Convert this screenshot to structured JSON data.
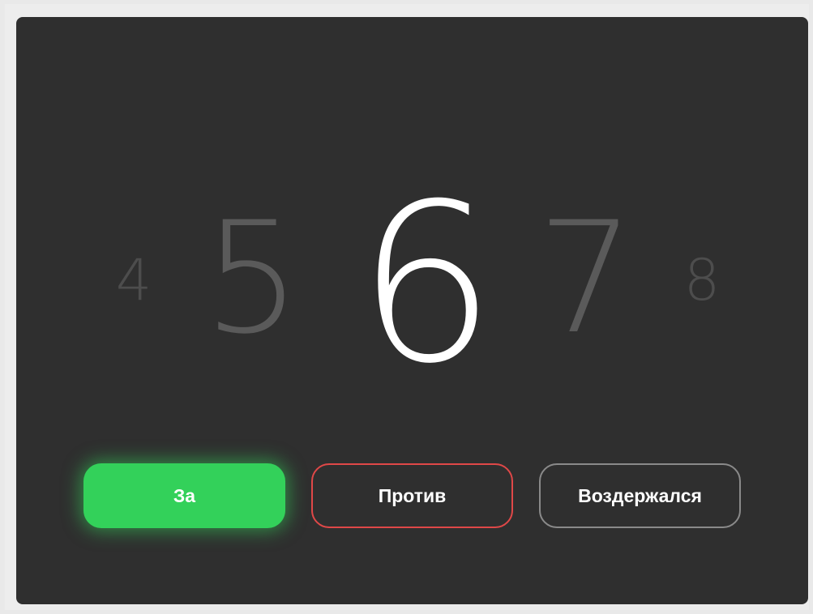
{
  "picker": {
    "values": [
      "4",
      "5",
      "6",
      "7",
      "8"
    ],
    "selected": "6"
  },
  "buttons": {
    "for_label": "За",
    "against_label": "Против",
    "abstain_label": "Воздержался"
  },
  "colors": {
    "panel_background": "#2f2f2f",
    "for_accent": "#33d15a",
    "against_accent": "#e04848",
    "abstain_border": "#8a8a8a"
  }
}
